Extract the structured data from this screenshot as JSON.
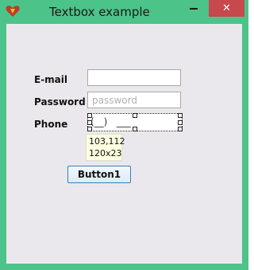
{
  "window": {
    "title": "Textbox example",
    "close_symbol": "✕",
    "icon": "heart-icon",
    "titlebar_color": "#4cc389",
    "close_color": "#c7484d"
  },
  "form": {
    "email": {
      "label": "E-mail",
      "value": ""
    },
    "password": {
      "label": "Password",
      "placeholder": "password"
    },
    "phone": {
      "label": "Phone",
      "mask": "(__)   ___"
    },
    "tooltip": {
      "location": "103,112",
      "size": "120x23"
    },
    "button_label": "Button1"
  }
}
